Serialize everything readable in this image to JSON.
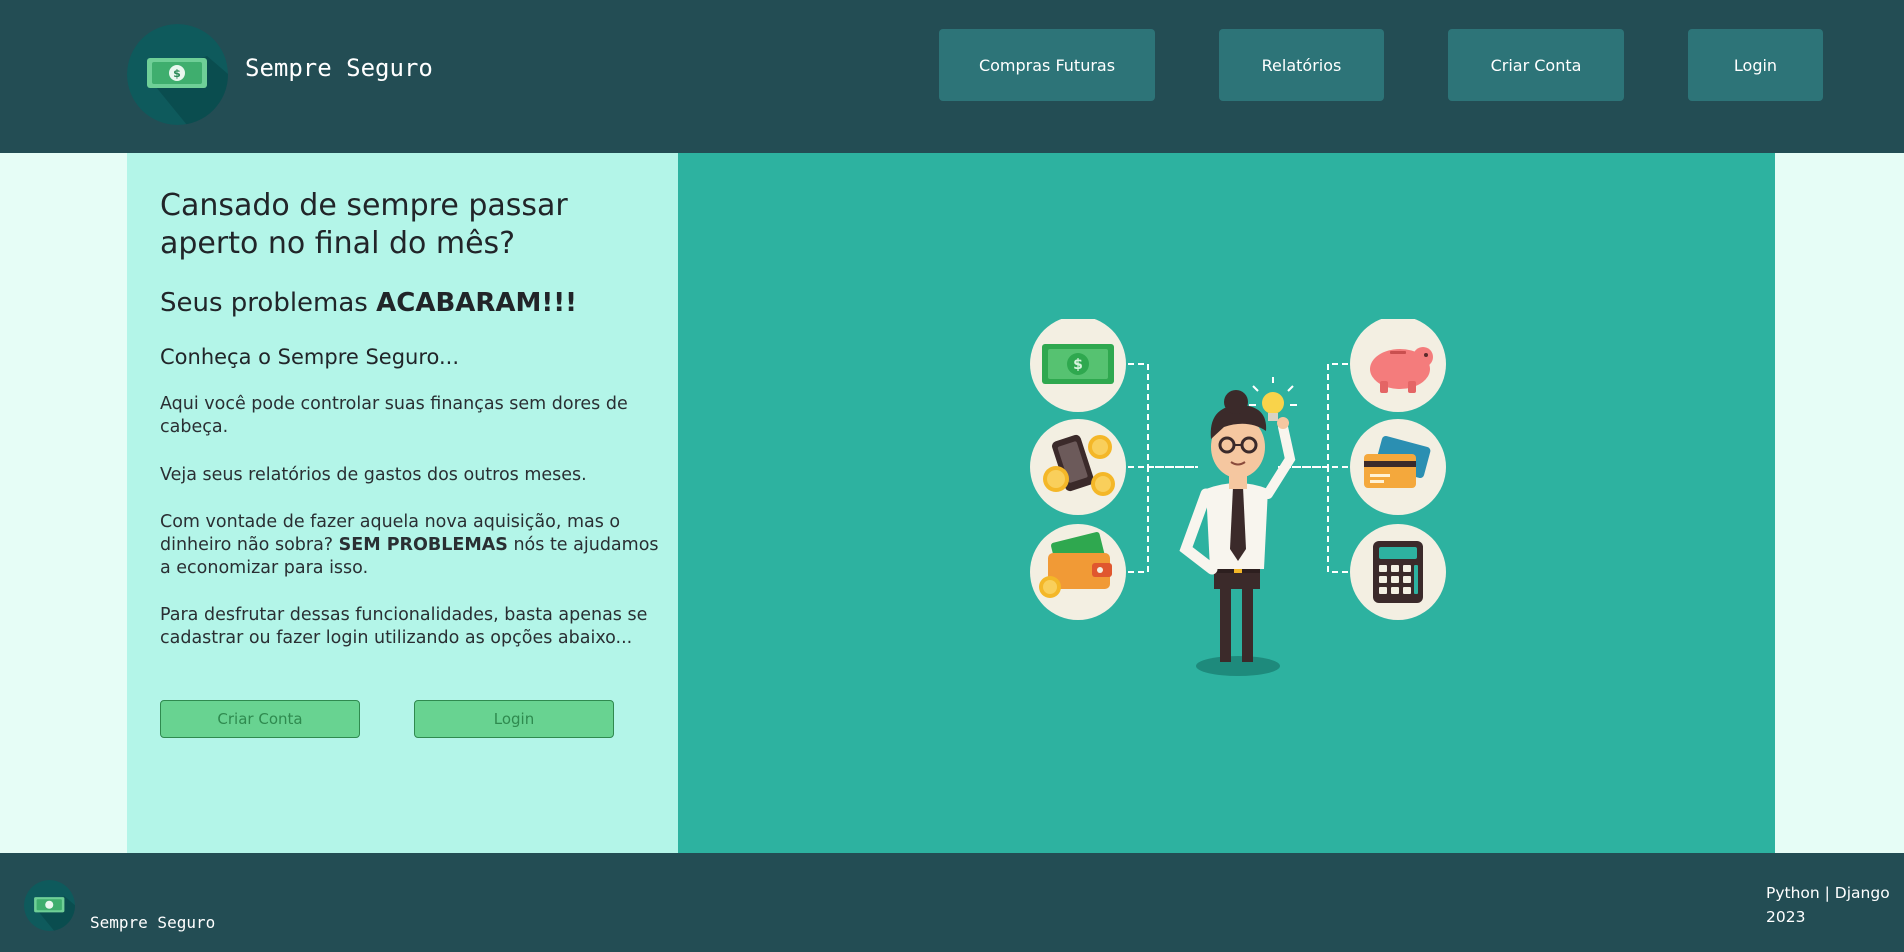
{
  "header": {
    "brand": "Sempre Seguro",
    "logo_icon": "money-bill-icon",
    "nav": [
      {
        "label": "Compras Futuras"
      },
      {
        "label": "Relatórios"
      },
      {
        "label": "Criar Conta"
      },
      {
        "label": "Login"
      }
    ]
  },
  "hero": {
    "title": "Cansado de sempre passar aperto no final do mês?",
    "subtitle_prefix": "Seus problemas ",
    "subtitle_emphasis": "ACABARAM!!!",
    "intro": "Conheça o Sempre Seguro...",
    "paragraph1": "Aqui você pode controlar suas finanças sem dores de cabeça.",
    "paragraph2": "Veja seus relatórios de gastos dos outros meses.",
    "paragraph3_prefix": "Com vontade de fazer aquela nova aquisição, mas o dinheiro não sobra? ",
    "paragraph3_emphasis": "SEM PROBLEMAS",
    "paragraph3_suffix": " nós te ajudamos a economizar para isso.",
    "paragraph4": "Para desfrutar dessas funcionalidades, basta apenas se cadastrar ou fazer login utilizando as opções abaixo...",
    "buttons": {
      "create_account": "Criar Conta",
      "login": "Login"
    }
  },
  "illustration": {
    "icons": [
      "money-bill-icon",
      "piggy-bank-icon",
      "phone-coins-icon",
      "credit-card-icon",
      "wallet-icon",
      "calculator-icon",
      "lightbulb-icon",
      "businessman-illustration"
    ]
  },
  "footer": {
    "brand": "Sempre Seguro",
    "tech": "Python | Django",
    "year": "2023"
  },
  "colors": {
    "header_bg": "#234d54",
    "nav_button_bg": "#2d7478",
    "left_panel_bg": "#b3f5e8",
    "right_panel_bg": "#2db2a0",
    "page_bg": "#e6fdf6",
    "cta_bg": "#68d391"
  }
}
